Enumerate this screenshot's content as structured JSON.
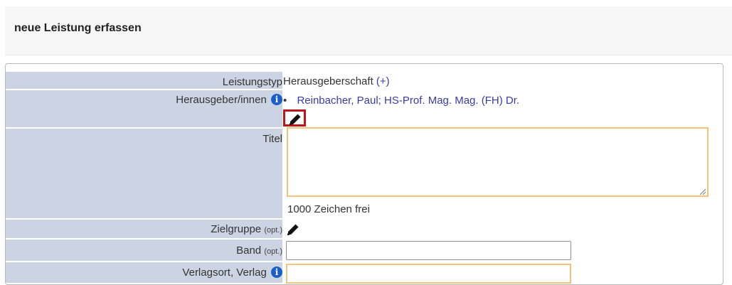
{
  "header": {
    "title": "neue Leistung erfassen"
  },
  "form": {
    "leistungstyp": {
      "label": "Leistungstyp",
      "value": "Herausgeberschaft",
      "add_link": "(+)"
    },
    "herausgeber": {
      "label": "Herausgeber/innen",
      "info_icon": "i",
      "bullet": "•",
      "person": "Reinbacher, Paul; HS-Prof. Mag. Mag. (FH) Dr."
    },
    "titel": {
      "label": "Titel",
      "value": "",
      "chars_left": "1000 Zeichen frei"
    },
    "zielgruppe": {
      "label": "Zielgruppe",
      "opt": "(opt.)"
    },
    "band": {
      "label": "Band",
      "opt": "(opt.)",
      "value": ""
    },
    "verlag": {
      "label": "Verlagsort, Verlag",
      "info_icon": "i",
      "value": ""
    }
  },
  "icons": {
    "edit": "pencil-icon",
    "info": "info-icon",
    "resize": "resize-grip-icon"
  },
  "colors": {
    "label_bg": "#ccd4e3",
    "link": "#3a3aa8",
    "highlight": "#c0141c",
    "focus_border": "#f5c27a"
  }
}
